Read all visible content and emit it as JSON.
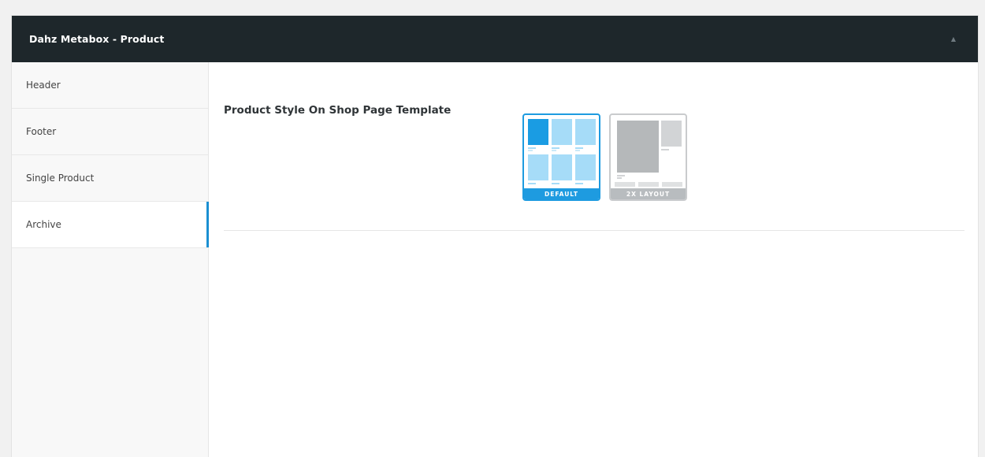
{
  "metabox": {
    "title": "Dahz Metabox - Product",
    "toggle_icon": "triangle-up-icon"
  },
  "sidebar": {
    "items": [
      {
        "label": "Header",
        "active": false
      },
      {
        "label": "Footer",
        "active": false
      },
      {
        "label": "Single Product",
        "active": false
      },
      {
        "label": "Archive",
        "active": true
      }
    ]
  },
  "content": {
    "field_label": "Product Style On Shop Page Template",
    "options": [
      {
        "label": "DEFAULT",
        "selected": true
      },
      {
        "label": "2X LAYOUT",
        "selected": false
      }
    ]
  },
  "colors": {
    "header_bg": "#1e272b",
    "accent": "#1e9be0",
    "thumb_light_blue": "#a6dcf8",
    "thumb_dark_blue": "#1a9ce3",
    "thumb_grey": "#b5b8ba"
  }
}
